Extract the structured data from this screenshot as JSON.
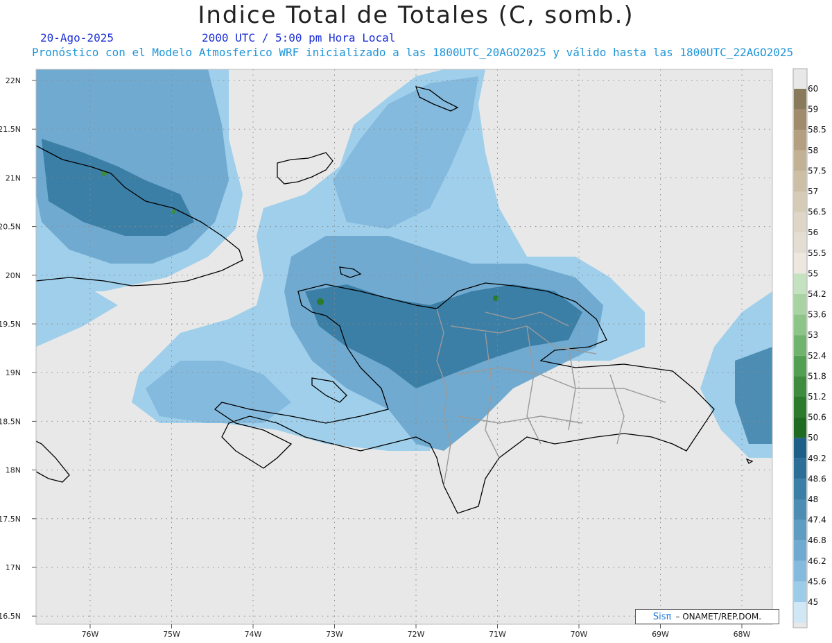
{
  "title": "Indice Total de Totales (C, somb.)",
  "date": "20-Ago-2025",
  "time": "2000 UTC / 5:00 pm Hora Local",
  "init_line": "Pronóstico con el Modelo Atmosferico WRF inicializado a las 1800UTC_20AGO2025 y válido hasta las  1800UTC_22AGO2025",
  "lat_labels": [
    "22N",
    "21.5N",
    "21N",
    "20.5N",
    "20N",
    "19.5N",
    "19N",
    "18.5N",
    "18N",
    "17.5N",
    "17N",
    "16.5N"
  ],
  "lon_labels": [
    "76W",
    "75W",
    "74W",
    "73W",
    "72W",
    "71W",
    "70W",
    "69W",
    "68W"
  ],
  "colorbar": {
    "labels": [
      "60",
      "59",
      "58.5",
      "58",
      "57.5",
      "57",
      "56.5",
      "56",
      "55.5",
      "55",
      "54.2",
      "53.6",
      "53",
      "52.4",
      "51.8",
      "51.2",
      "50.6",
      "50",
      "49.2",
      "48.6",
      "48",
      "47.4",
      "46.8",
      "46.2",
      "45.6",
      "45"
    ],
    "colors": [
      "#8a7a5c",
      "#a08c6c",
      "#b4a080",
      "#c2b194",
      "#cdbfa6",
      "#d6cbb6",
      "#ddd5c5",
      "#e4ded2",
      "#ece8df",
      "#c5e2c0",
      "#a9d3a2",
      "#8dc487",
      "#70b36c",
      "#54a052",
      "#3f8c3e",
      "#2c7a2c",
      "#1f6b22",
      "#1e5f88",
      "#2b6f98",
      "#3b7ea6",
      "#4d8db4",
      "#5e9cc2",
      "#70aad0",
      "#84badd",
      "#9bcde9",
      "#d0e8f5"
    ]
  },
  "credit": {
    "logo": "Sisπ",
    "org": "– ONAMET/REP.DOM."
  }
}
